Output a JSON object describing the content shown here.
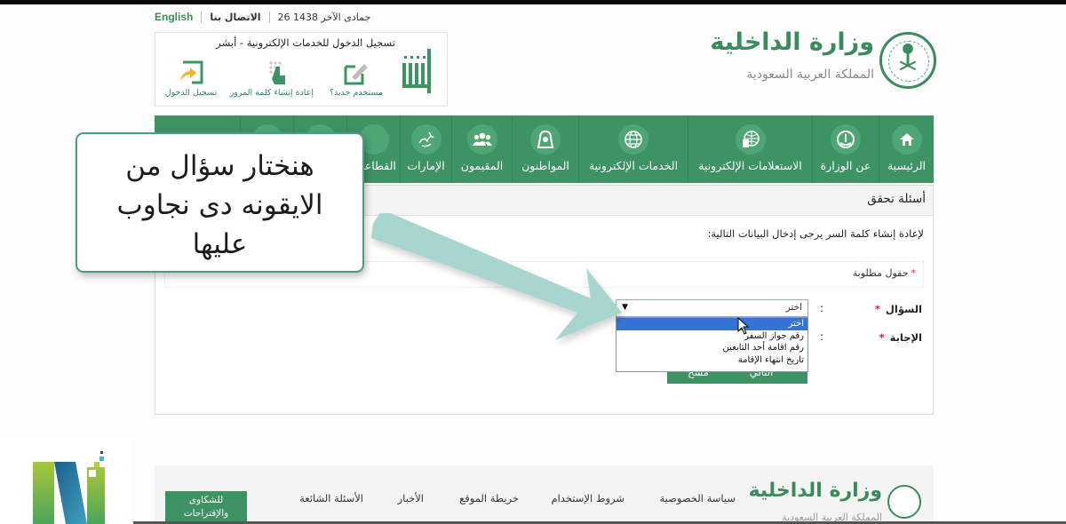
{
  "toplinks": {
    "english": "English",
    "contact": "الاتصال بنا",
    "date": "26 جمادى الآخر 1438"
  },
  "absher": {
    "title": "تسجيل الدخول للخدمات الإلكترونية - أبشر",
    "logo_text": "أبشر",
    "actions": [
      {
        "label": "مستخدم جديد؟",
        "icon": "edit-pencil-icon"
      },
      {
        "label": "إعادة إنشاء كلمة المرور",
        "icon": "keypad-finger-icon"
      },
      {
        "label": "تسجيل الدخول",
        "icon": "login-arrow-icon"
      }
    ]
  },
  "ministry": {
    "name": "وزارة الداخلية",
    "country": "المملكة العربية السعودية"
  },
  "nav": {
    "items": [
      {
        "label": "الرئيسية",
        "icon": "home-icon"
      },
      {
        "label": "عن الوزارة",
        "icon": "ministry-emblem-icon"
      },
      {
        "label": "الاستعلامات الإلكترونية",
        "icon": "globe-search-icon"
      },
      {
        "label": "الخدمات الإلكترونية",
        "icon": "globe-icon"
      },
      {
        "label": "المواطنون",
        "icon": "citizen-icon"
      },
      {
        "label": "المقيمون",
        "icon": "residents-group-icon"
      },
      {
        "label": "الإمارات",
        "icon": "emirates-calligraphy-icon"
      },
      {
        "label": "القطاعات",
        "icon": "sectors-icon"
      },
      {
        "label": "",
        "icon": "nav-icon"
      },
      {
        "label": "",
        "icon": "nav-icon"
      }
    ]
  },
  "panel": {
    "title": "أسئلة تحقق",
    "intro": "لإعادة إنشاء كلمة السر يرجى إدخال البيانات التالية:",
    "required_note": "حقول مطلوبة",
    "question_label": "السؤال",
    "answer_label": "الإجابة",
    "colon": ":",
    "select_value": "اختر",
    "select_options": [
      "اختر",
      "رقم جواز السفر",
      "رقم اقامة أحد التابعين",
      "تاريخ انتهاء الإقامة"
    ],
    "selected_index": 0,
    "next_button": "التالي",
    "clear_button": "مسح"
  },
  "footer": {
    "ministry_name": "وزارة الداخلية",
    "country": "المملكة العربية السعودية",
    "links": [
      "سياسة الخصوصية",
      "شروط الإستخدام",
      "خريطة الموقع",
      "الأخبار",
      "الأسئلة الشائعة"
    ],
    "complaints_button": [
      "للشكاوى",
      "والإقتراحات"
    ]
  },
  "callout": {
    "lines": [
      "هنختار سؤال من",
      "الايقونه دى نجاوب",
      "عليها"
    ]
  },
  "colors": {
    "brand_green": "#3d9364",
    "accent_teal_arrow": "#a9d5cf",
    "selection_blue": "#3574d6"
  }
}
